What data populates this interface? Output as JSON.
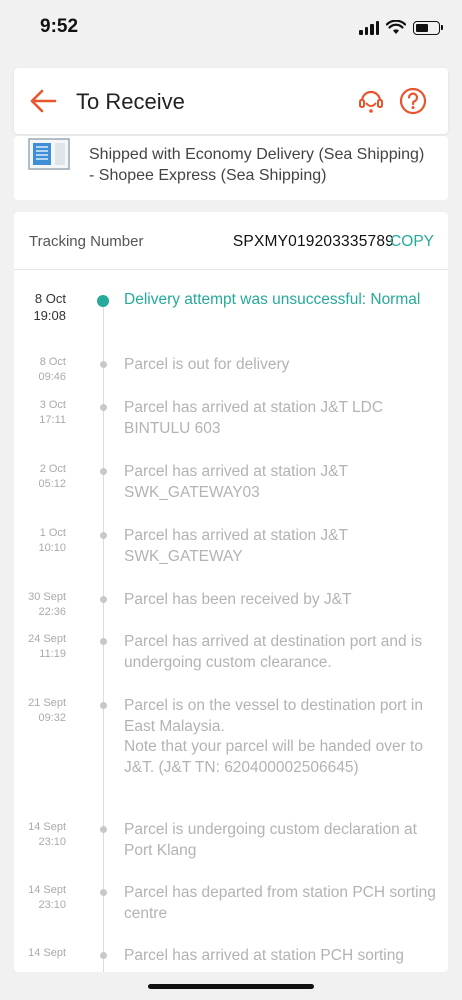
{
  "status_bar": {
    "time": "9:52"
  },
  "header": {
    "title": "To Receive",
    "accent_color": "#e8542e"
  },
  "shipping": {
    "description": "Shipped with Economy Delivery (Sea Shipping) - Shopee Express (Sea Shipping)"
  },
  "tracking": {
    "label": "Tracking Number",
    "number": "SPXMY019203335789",
    "copy_label": "COPY",
    "accent_color": "#26aa99",
    "events": [
      {
        "date": "8 Oct",
        "time": "19:08",
        "text": "Delivery attempt was unsuccessful: Normal",
        "active": true
      },
      {
        "date": "8 Oct",
        "time": "09:46",
        "text": "Parcel is out for delivery"
      },
      {
        "date": "3 Oct",
        "time": "17:11",
        "text": "Parcel has arrived at station J&T LDC BINTULU 603"
      },
      {
        "date": "2 Oct",
        "time": "05:12",
        "text": "Parcel has arrived at station J&T SWK_GATEWAY03"
      },
      {
        "date": "1 Oct",
        "time": "10:10",
        "text": "Parcel has arrived at station J&T SWK_GATEWAY"
      },
      {
        "date": "30 Sept",
        "time": "22:36",
        "text": "Parcel has been received by J&T"
      },
      {
        "date": "24 Sept",
        "time": "11:19",
        "text": "Parcel has arrived at destination port and is undergoing custom clearance."
      },
      {
        "date": "21 Sept",
        "time": "09:32",
        "text": "Parcel is on the vessel to destination port in East Malaysia.\nNote that your parcel will be handed over to J&T. (J&T TN: 620400002506645)"
      },
      {
        "date": "14 Sept",
        "time": "23:10",
        "text": "Parcel is undergoing custom declaration at Port Klang"
      },
      {
        "date": "14 Sept",
        "time": "23:10",
        "text": "Parcel has departed from station PCH sorting centre"
      },
      {
        "date": "14 Sept",
        "time": "",
        "text": "Parcel has arrived at station PCH sorting"
      }
    ]
  }
}
